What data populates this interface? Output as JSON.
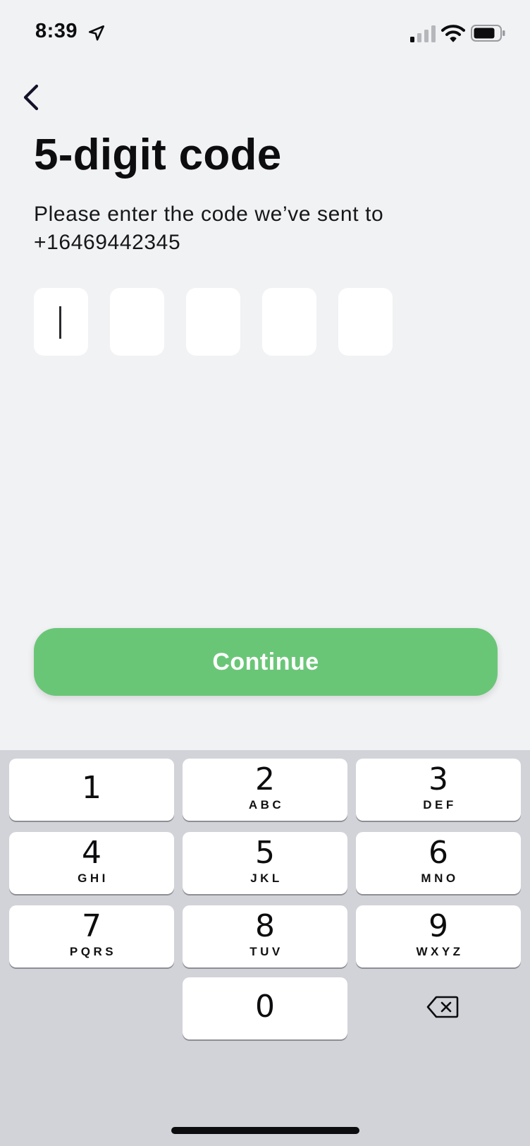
{
  "status_bar": {
    "time": "8:39",
    "icons": [
      "location-arrow-icon",
      "cellular-signal-icon",
      "wifi-icon",
      "battery-icon"
    ]
  },
  "header": {
    "back_icon": "chevron-left-icon",
    "title": "5-digit code",
    "subtitle_line1": "Please enter the code we’ve sent to",
    "subtitle_line2": "+16469442345"
  },
  "code_input": {
    "length": 5,
    "digits": [
      "",
      "",
      "",
      "",
      ""
    ],
    "focused_index": 0
  },
  "continue_button": {
    "label": "Continue",
    "color": "#6ac677"
  },
  "keypad": {
    "keys": [
      {
        "num": "1",
        "letters": ""
      },
      {
        "num": "2",
        "letters": "ABC"
      },
      {
        "num": "3",
        "letters": "DEF"
      },
      {
        "num": "4",
        "letters": "GHI"
      },
      {
        "num": "5",
        "letters": "JKL"
      },
      {
        "num": "6",
        "letters": "MNO"
      },
      {
        "num": "7",
        "letters": "PQRS"
      },
      {
        "num": "8",
        "letters": "TUV"
      },
      {
        "num": "9",
        "letters": "WXYZ"
      },
      {
        "num": "0",
        "letters": ""
      }
    ],
    "delete_icon": "backspace-icon"
  },
  "colors": {
    "background": "#f1f2f4",
    "keypad_background": "#d2d3d8",
    "accent": "#6ac677"
  }
}
